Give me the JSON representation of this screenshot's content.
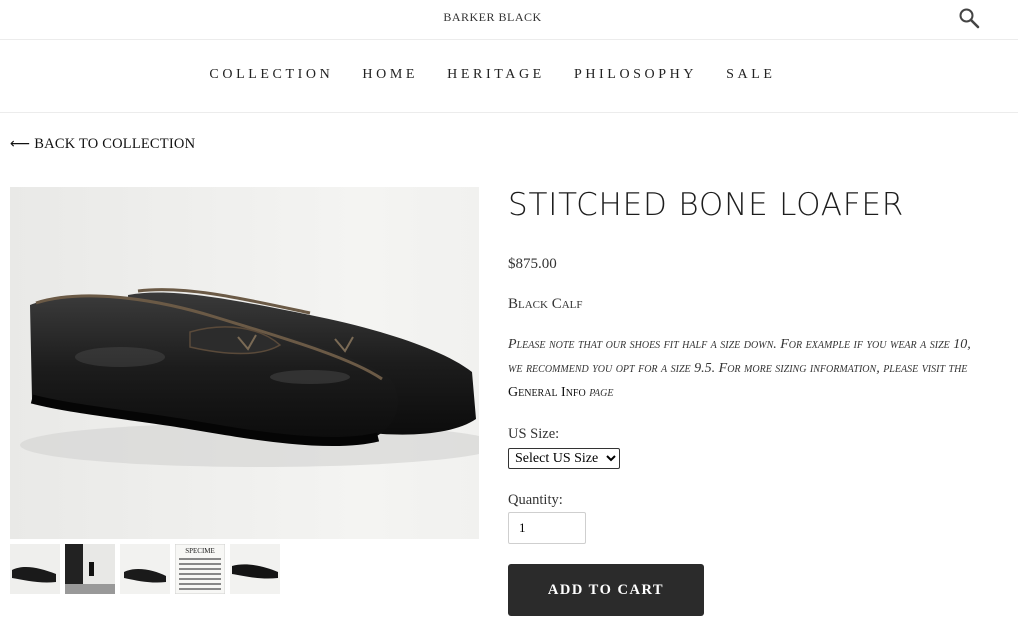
{
  "header": {
    "brand": "BARKER BLACK",
    "search_icon": "search-icon"
  },
  "nav": {
    "items": [
      {
        "label": "COLLECTION"
      },
      {
        "label": "HOME"
      },
      {
        "label": "HERITAGE"
      },
      {
        "label": "PHILOSOPHY"
      },
      {
        "label": "SALE"
      }
    ]
  },
  "back_link": {
    "icon": "arrow-left-icon",
    "arrow": "⟵",
    "label": "BACK TO COLLECTION"
  },
  "product": {
    "title": "STITCHED BONE LOAFER",
    "price": "$875.00",
    "material": "Black Calf",
    "note_text": "Please note that our shoes fit half a size down. For example if you wear a size 10, we recommend you opt for a size 9.5. For more sizing information, please visit the",
    "note_link": "General Info",
    "note_suffix": "page",
    "size_label": "US Size:",
    "size_selected": "Select US Size",
    "quantity_label": "Quantity:",
    "quantity_value": "1",
    "add_to_cart": "ADD TO CART"
  },
  "gallery": {
    "main_image": "black-calf-loafer-pair-photo",
    "thumbnails": [
      {
        "name": "thumbnail-loafer-pair"
      },
      {
        "name": "thumbnail-studio-interior"
      },
      {
        "name": "thumbnail-loafer-side"
      },
      {
        "name": "thumbnail-specimen-sheet",
        "caption": "SPECIME"
      },
      {
        "name": "thumbnail-loafer-sole"
      }
    ]
  },
  "colors": {
    "accent": "#2b2b2b",
    "text": "#222222",
    "divider": "#ececec"
  }
}
